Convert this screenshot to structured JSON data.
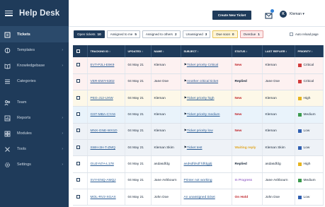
{
  "app": {
    "title": "Help Desk"
  },
  "sidebar": {
    "items": [
      {
        "label": "Tickets",
        "icon": "ticket-icon",
        "active": true,
        "has_chevron": false
      },
      {
        "label": "Templates",
        "icon": "template-icon",
        "active": false,
        "has_chevron": true
      },
      {
        "label": "Knowledgebase",
        "icon": "book-icon",
        "active": false,
        "has_chevron": true
      },
      {
        "label": "Categories",
        "icon": "list-icon",
        "active": false,
        "has_chevron": false
      },
      {
        "label": "Team",
        "icon": "team-icon",
        "active": false,
        "has_chevron": false
      },
      {
        "label": "Reports",
        "icon": "chart-icon",
        "active": false,
        "has_chevron": true
      },
      {
        "label": "Modules",
        "icon": "grid-icon",
        "active": false,
        "has_chevron": true
      },
      {
        "label": "Tools",
        "icon": "tools-icon",
        "active": false,
        "has_chevron": true
      },
      {
        "label": "Settings",
        "icon": "gear-icon",
        "active": false,
        "has_chevron": true
      }
    ],
    "chevron": "›"
  },
  "header": {
    "create_label": "Create New Ticket",
    "user_initial": "K",
    "user_name": "Kleman ▾"
  },
  "filters": [
    {
      "label": "Open tickets",
      "count": "10",
      "variant": "active"
    },
    {
      "label": "Assigned to me",
      "count": "5",
      "variant": ""
    },
    {
      "label": "Assigned to others",
      "count": "2",
      "variant": ""
    },
    {
      "label": "Unassigned",
      "count": "3",
      "variant": ""
    },
    {
      "label": "Due soon",
      "count": "0",
      "variant": "due"
    },
    {
      "label": "Overdue",
      "count": "1",
      "variant": "overdue"
    }
  ],
  "auto_refresh_label": "Auto reload page",
  "table": {
    "columns": [
      "TRACKING ID ↕",
      "UPDATED ↕",
      "NAME ↕",
      "SUBJECT ↕",
      "STATUS ↕",
      "LAST REPLIER ↕",
      "PRIORITY ↕"
    ],
    "rows": [
      {
        "id": "EVT-P2LI-E9K9",
        "updated": "04 May 21",
        "name": "Kleman",
        "subject": "Ticket priority Critical",
        "has_icon": true,
        "status": "New",
        "status_class": "st-new",
        "replier": "Kleman",
        "priority": "Critical",
        "row_class": "row-critical"
      },
      {
        "id": "VER-EWY-6302",
        "updated": "04 May 21",
        "name": "Jane Doe",
        "subject": "Another critical ticket",
        "has_icon": true,
        "status": "Replied",
        "status_class": "st-replied",
        "replier": "Jane Doe",
        "priority": "Critical",
        "row_class": "row-critical"
      },
      {
        "id": "PEG-J12-UXW",
        "updated": "04 May 21",
        "name": "Kleman",
        "subject": "Ticket priority high",
        "has_icon": true,
        "status": "New",
        "status_class": "st-new",
        "replier": "Kleman",
        "priority": "High",
        "row_class": "row-high"
      },
      {
        "id": "GST-MBA-CYA6",
        "updated": "04 May 21",
        "name": "Kleman",
        "subject": "Ticket priority medium",
        "has_icon": true,
        "status": "New",
        "status_class": "st-new",
        "replier": "Kleman",
        "priority": "Medium",
        "row_class": "row-medium"
      },
      {
        "id": "MNX-GNE-WX1D",
        "updated": "04 May 21",
        "name": "Kleman",
        "subject": "Ticket priority low",
        "has_icon": true,
        "status": "New",
        "status_class": "st-new",
        "replier": "Kleman",
        "priority": "Low",
        "row_class": "row-low"
      },
      {
        "id": "SWH-3H-T-ZMQ",
        "updated": "04 May 21",
        "name": "Kleman Skim",
        "subject": "Ticket test",
        "has_icon": true,
        "status": "Waiting reply",
        "status_class": "st-waiting",
        "replier": "Kleman Skim",
        "priority": "Low",
        "row_class": "row-low"
      },
      {
        "id": "GUZ-N7A-L178",
        "updated": "04 May 21",
        "name": "asdasdfdg",
        "subject": "asdsdfdsdf fdfdgjdj",
        "has_icon": false,
        "status": "Replied",
        "status_class": "st-replied",
        "replier": "asdasdfdg",
        "priority": "High",
        "row_class": "row-plain"
      },
      {
        "id": "SVY-ENQ-AMQJ",
        "updated": "04 May 21",
        "name": "Jane Ashbourn",
        "subject": "Printer not working",
        "has_icon": false,
        "status": "In Progress",
        "status_class": "st-progress",
        "replier": "Jane Ashbourn",
        "priority": "Medium",
        "row_class": "row-plain"
      },
      {
        "id": "MOL-RV2-XGAX",
        "updated": "04 May 21",
        "name": "John Doe",
        "subject": "An unassigned ticket",
        "has_icon": false,
        "status": "On Hold",
        "status_class": "st-hold",
        "replier": "John Doe",
        "priority": "Low",
        "row_class": "row-plain"
      }
    ]
  },
  "colors": {
    "sidebar": "#1f3b5a",
    "critical": "#d23b3b",
    "high": "#e6b41f",
    "medium": "#3d9b4f",
    "low": "#2f5fb0"
  }
}
